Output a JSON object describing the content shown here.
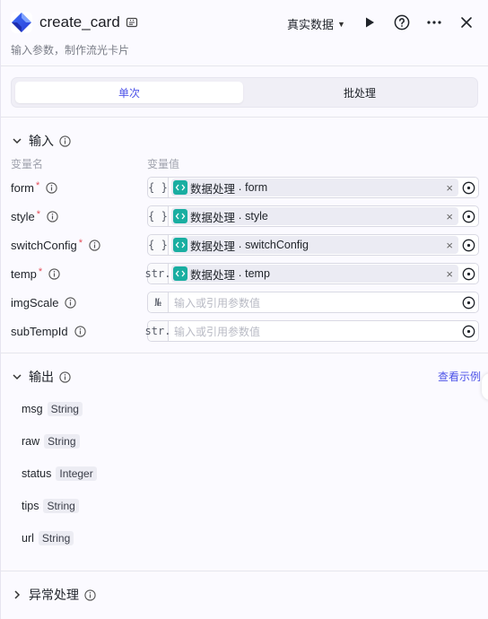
{
  "header": {
    "title": "create_card",
    "description": "输入参数，制作流光卡片",
    "env_label": "真实数据",
    "icons": {
      "app": "node-icon",
      "edit": "edit-icon",
      "run": "play-icon",
      "help": "help-icon",
      "more": "more-icon",
      "close": "close-icon"
    }
  },
  "tabs": {
    "single": "单次",
    "batch": "批处理",
    "active": "single"
  },
  "input": {
    "title": "输入",
    "col_name": "变量名",
    "col_value": "变量值",
    "params": [
      {
        "name": "form",
        "required": "*",
        "type": "{ }",
        "ref_prefix": "数据处理 ·",
        "ref_name": "form",
        "clear": "×"
      },
      {
        "name": "style",
        "required": "*",
        "type": "{ }",
        "ref_prefix": "数据处理 ·",
        "ref_name": "style",
        "clear": "×"
      },
      {
        "name": "switchConfig",
        "required": "*",
        "type": "{ }",
        "ref_prefix": "数据处理 ·",
        "ref_name": "switchConfig",
        "clear": "×"
      },
      {
        "name": "temp",
        "required": "*",
        "type": "str.",
        "ref_prefix": "数据处理 ·",
        "ref_name": "temp",
        "clear": "×"
      },
      {
        "name": "imgScale",
        "type": "№",
        "placeholder": "输入或引用参数值"
      },
      {
        "name": "subTempId",
        "type": "str.",
        "placeholder": "输入或引用参数值"
      }
    ]
  },
  "output": {
    "title": "输出",
    "view_example": "查看示例",
    "items": [
      {
        "name": "msg",
        "type": "String"
      },
      {
        "name": "raw",
        "type": "String"
      },
      {
        "name": "status",
        "type": "Integer"
      },
      {
        "name": "tips",
        "type": "String"
      },
      {
        "name": "url",
        "type": "String"
      }
    ]
  },
  "exception": {
    "title": "异常处理"
  },
  "colors": {
    "accent": "#4d53e8",
    "ref_icon": "#1aaea1",
    "required": "#e34d59"
  }
}
